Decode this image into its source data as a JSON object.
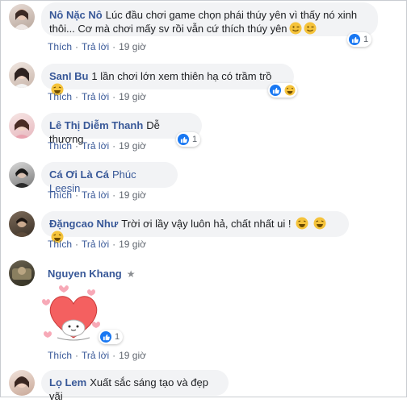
{
  "comments": [
    {
      "name": "Nô Nặc Nô",
      "text_line1": "Lúc đầu chơi game chọn phái thúy yên vì thấy nó xinh",
      "text_line2": "thôi... Cơ mà chơi mấy sv rồi vẫn cứ thích thúy yên",
      "reaction_count": "1",
      "actions": {
        "like": "Thích",
        "reply": "Trả lời",
        "time": "19 giờ"
      }
    },
    {
      "name": "SanI Bu",
      "text": "1 lần chơi lớn xem thiên hạ có trầm trồ",
      "actions": {
        "like": "Thích",
        "reply": "Trả lời",
        "time": "19 giờ"
      }
    },
    {
      "name": "Lê Thị Diễm Thanh",
      "text": "Dễ thương",
      "reaction_count": "1",
      "actions": {
        "like": "Thích",
        "reply": "Trả lời",
        "time": "19 giờ"
      }
    },
    {
      "name": "Cá Ơi Là Cá",
      "tag": "Phúc Leesin",
      "actions": {
        "like": "Thích",
        "reply": "Trả lời",
        "time": "19 giờ"
      }
    },
    {
      "name": "Đặngcao Như",
      "text": "Trời ơi lầy vậy luôn hả, chất nhất ui !",
      "actions": {
        "like": "Thích",
        "reply": "Trả lời",
        "time": "19 giờ"
      }
    },
    {
      "name": "Nguyen Khang",
      "reaction_count": "1",
      "actions": {
        "like": "Thích",
        "reply": "Trả lời",
        "time": "19 giờ"
      }
    },
    {
      "name": "Lọ Lem",
      "text": "Xuất sắc sáng tạo và đẹp vãi"
    }
  ],
  "colors": {
    "link": "#385898",
    "bubble": "#f2f3f5",
    "like": "#1877f2",
    "meta": "#616770"
  },
  "icons": [
    "like-icon",
    "haha-icon",
    "wink-emoji-icon",
    "star-icon",
    "heart-sticker"
  ]
}
